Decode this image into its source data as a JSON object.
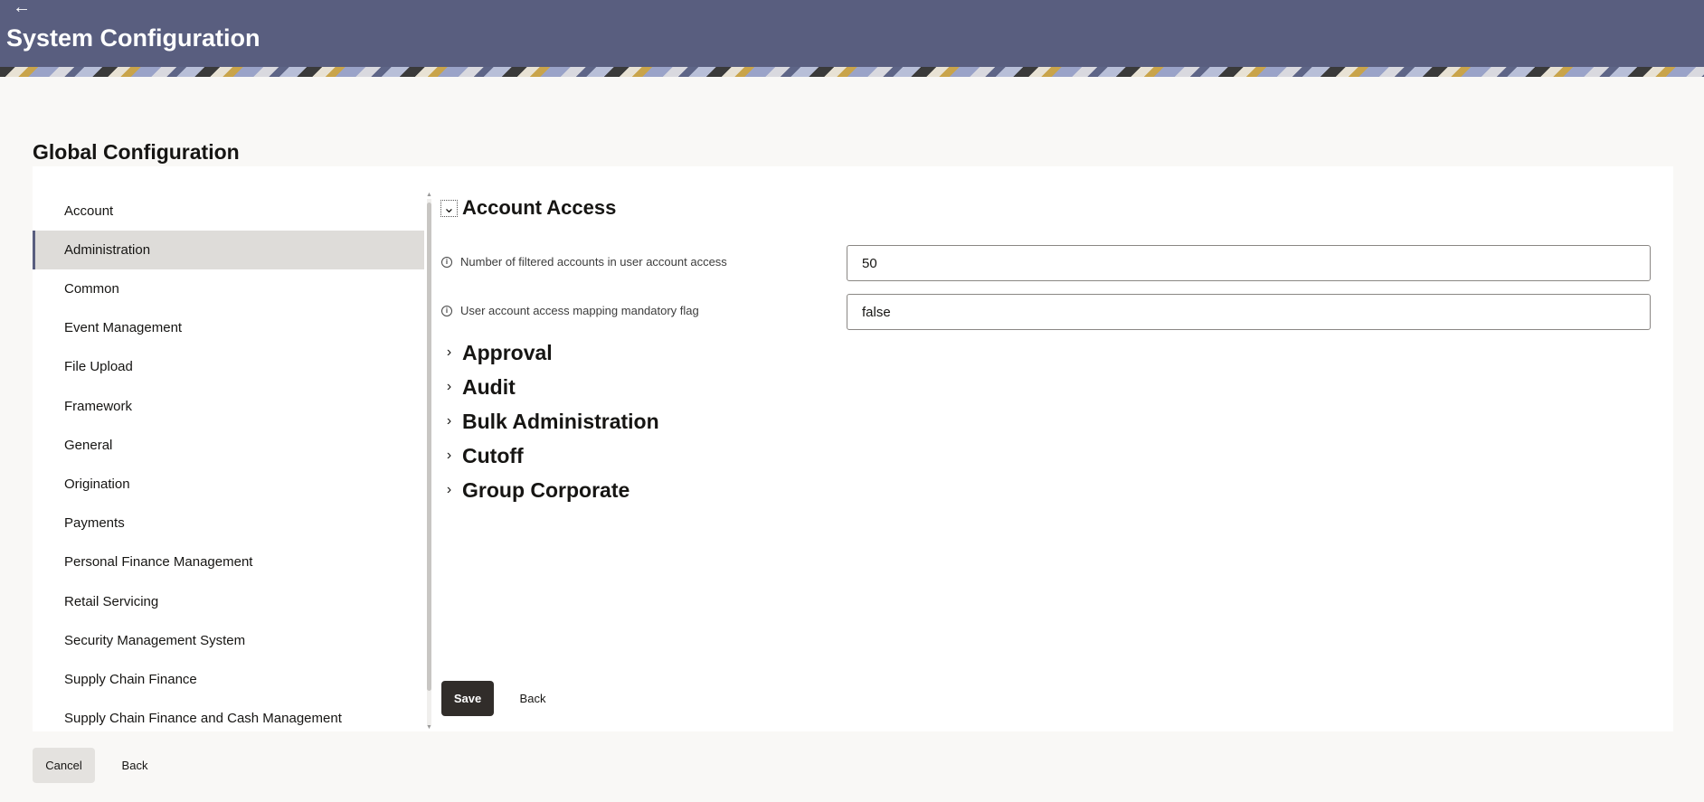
{
  "header": {
    "back_icon": "arrow-left-icon",
    "title": "System Configuration"
  },
  "section_title": "Global Configuration",
  "sidebar": {
    "selected": "Administration",
    "items": [
      {
        "label": "Account"
      },
      {
        "label": "Administration"
      },
      {
        "label": "Common"
      },
      {
        "label": "Event Management"
      },
      {
        "label": "File Upload"
      },
      {
        "label": "Framework"
      },
      {
        "label": "General"
      },
      {
        "label": "Origination"
      },
      {
        "label": "Payments"
      },
      {
        "label": "Personal Finance Management"
      },
      {
        "label": "Retail Servicing"
      },
      {
        "label": "Security Management System"
      },
      {
        "label": "Supply Chain Finance"
      },
      {
        "label": "Supply Chain Finance and Cash Management"
      }
    ]
  },
  "main": {
    "expanded_section": {
      "title": "Account Access",
      "fields": [
        {
          "label": "Number of filtered accounts in user account access",
          "value": "50"
        },
        {
          "label": "User account access mapping mandatory flag",
          "value": "false"
        }
      ]
    },
    "collapsed_sections": [
      {
        "title": "Approval"
      },
      {
        "title": "Audit"
      },
      {
        "title": "Bulk Administration"
      },
      {
        "title": "Cutoff"
      },
      {
        "title": "Group Corporate"
      }
    ],
    "save_label": "Save",
    "back_label": "Back"
  },
  "footer": {
    "cancel_label": "Cancel",
    "back_label": "Back"
  },
  "colors": {
    "header_bg": "#595e7f",
    "primary_button": "#312d2a",
    "selected_item_bg": "#dedcd9"
  }
}
